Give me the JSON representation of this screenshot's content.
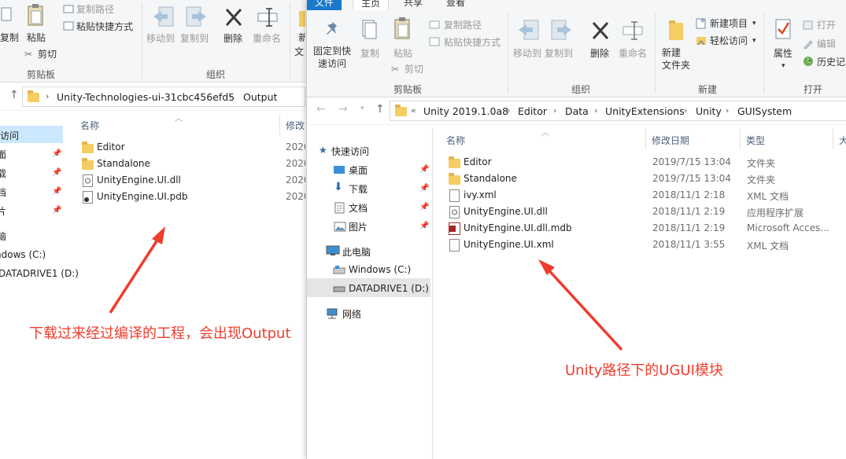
{
  "left_window": {
    "ribbon": {
      "copy_label_partial": "复制",
      "paste_label": "粘贴",
      "copy_path": "复制路径",
      "paste_shortcut": "粘贴快捷方式",
      "cut": "剪切",
      "clipboard_group": "剪贴板",
      "move_to": "移动到",
      "copy_to": "复制到",
      "delete": "删除",
      "rename": "重命名",
      "organize_group": "组织",
      "new_partial_1": "新",
      "new_partial_2": "文"
    },
    "breadcrumb": [
      "Unity-Technologies-ui-31cbc456efd5",
      "Output"
    ],
    "nav": {
      "quick_access_partial": "访问",
      "pinned_partial": [
        "面",
        "载",
        "档",
        "片"
      ],
      "this_pc_partial": "脑",
      "drive_c_partial": "ndows (C:)",
      "drive_d_partial": "DATADRIVE1 (D:)"
    },
    "columns": {
      "name": "名称",
      "date_partial": "修改"
    },
    "files": [
      {
        "name": "Editor",
        "date": "2020",
        "type": "folder"
      },
      {
        "name": "Standalone",
        "date": "2020",
        "type": "folder"
      },
      {
        "name": "UnityEngine.UI.dll",
        "date": "2020",
        "type": "dll"
      },
      {
        "name": "UnityEngine.UI.pdb",
        "date": "2020",
        "type": "pdb"
      }
    ]
  },
  "right_window": {
    "tabs": {
      "file": "文件",
      "home": "主页",
      "share": "共享",
      "view": "查看"
    },
    "ribbon": {
      "pin_quick_access": "固定到快\n速访问",
      "copy": "复制",
      "paste": "粘贴",
      "copy_path": "复制路径",
      "paste_shortcut": "粘贴快捷方式",
      "cut": "剪切",
      "clipboard_group": "剪贴板",
      "move_to": "移动到",
      "copy_to": "复制到",
      "delete": "删除",
      "rename": "重命名",
      "organize_group": "组织",
      "new_folder": "新建\n文件夹",
      "new_item": "新建项目",
      "easy_access": "轻松访问",
      "new_group": "新建",
      "properties": "属性",
      "open": "打开",
      "edit": "编辑",
      "history": "历史记",
      "open_group": "打开"
    },
    "breadcrumb": [
      "Unity 2019.1.0a8",
      "Editor",
      "Data",
      "UnityExtensions",
      "Unity",
      "GUISystem"
    ],
    "nav": {
      "quick_access": "快速访问",
      "desktop": "桌面",
      "downloads": "下载",
      "documents": "文档",
      "pictures": "图片",
      "this_pc": "此电脑",
      "drive_c": "Windows (C:)",
      "drive_d": "DATADRIVE1 (D:)",
      "network": "网络"
    },
    "columns": {
      "name": "名称",
      "date": "修改日期",
      "type": "类型",
      "size_partial": "大"
    },
    "files": [
      {
        "name": "Editor",
        "date": "2019/7/15 13:04",
        "type": "文件夹",
        "icon": "folder"
      },
      {
        "name": "Standalone",
        "date": "2019/7/15 13:04",
        "type": "文件夹",
        "icon": "folder"
      },
      {
        "name": "ivy.xml",
        "date": "2018/11/1 2:18",
        "type": "XML 文档",
        "icon": "xml"
      },
      {
        "name": "UnityEngine.UI.dll",
        "date": "2018/11/1 2:19",
        "type": "应用程序扩展",
        "icon": "dll"
      },
      {
        "name": "UnityEngine.UI.dll.mdb",
        "date": "2018/11/1 2:19",
        "type": "Microsoft Acces...",
        "icon": "mdb"
      },
      {
        "name": "UnityEngine.UI.xml",
        "date": "2018/11/1 3:55",
        "type": "XML 文档",
        "icon": "xml"
      }
    ]
  },
  "annotations": {
    "left": "下载过来经过编译的工程，会出现Output",
    "right": "Unity路径下的UGUI模块",
    "color": "#f03c2d"
  }
}
